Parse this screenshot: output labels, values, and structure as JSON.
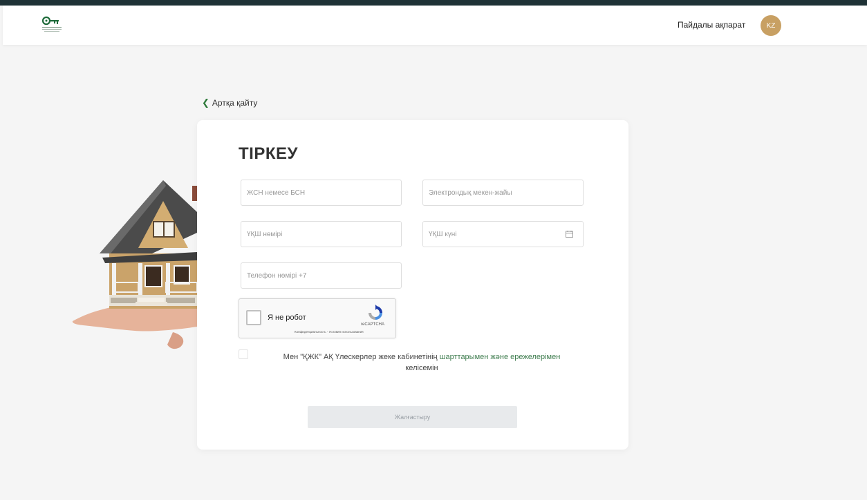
{
  "header": {
    "nav_useful_info": "Пайдалы ақпарат",
    "language": "KZ"
  },
  "back_link": "Артқа қайту",
  "form": {
    "title": "ТІРКЕУ",
    "fields": {
      "iin": "ЖСН немесе БСН",
      "email": "Электрондық мекен-жайы",
      "id_number": "ҮҚШ нөмірі",
      "id_date": "ҮҚШ күні",
      "phone": "Телефон нөмірі +7"
    },
    "captcha": {
      "label": "Я не робот",
      "brand": "reCAPTCHA",
      "links": "Конфиденциальность - Условия использования"
    },
    "agreement": {
      "text_before": "Мен \"ҚЖК\" АҚ Үлескерлер жеке кабинетінің ",
      "link": "шарттарымен және ережелерімен",
      "text_after": " келісемін"
    },
    "submit_label": "Жалғастыру"
  },
  "colors": {
    "accent_green": "#2e7a3a",
    "lang_badge": "#c8a063",
    "link": "#3f7d4f"
  }
}
